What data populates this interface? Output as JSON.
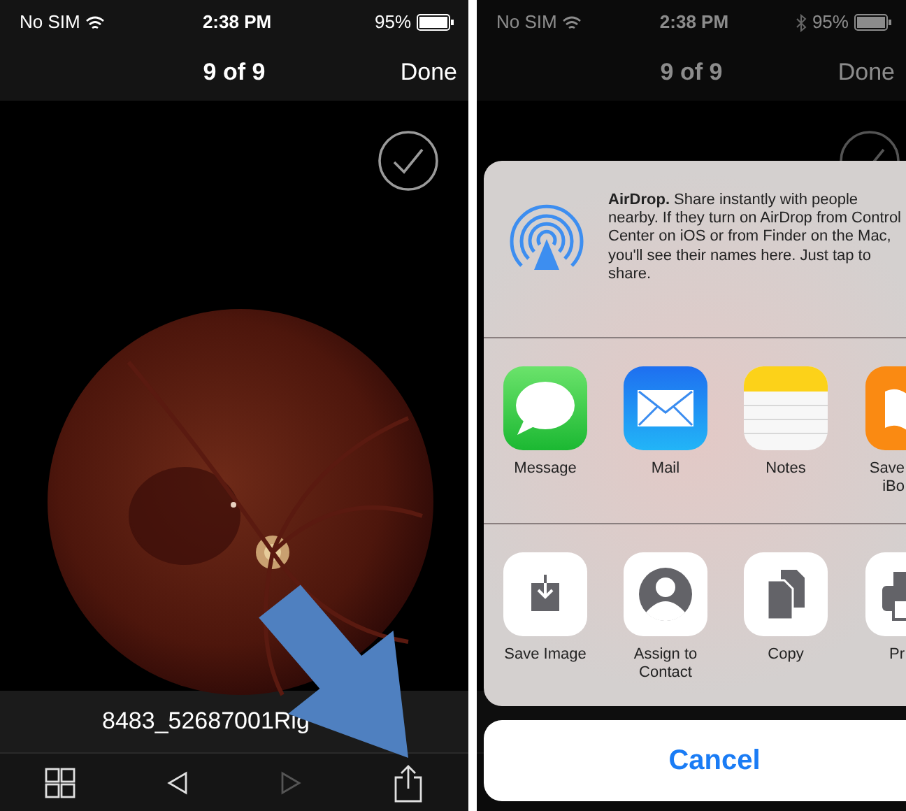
{
  "screens": [
    {
      "status_bar": {
        "carrier": "No SIM",
        "time": "2:38 PM",
        "bluetooth": false,
        "battery": "95%"
      },
      "nav": {
        "title": "9 of 9",
        "action": "Done"
      },
      "caption": "8483_52687001Rig",
      "toolbar": [
        {
          "kind": "grid",
          "disabled": false
        },
        {
          "kind": "prev",
          "disabled": false
        },
        {
          "kind": "next",
          "disabled": true
        },
        {
          "kind": "share",
          "disabled": false
        }
      ],
      "pointer": {
        "kind": "arrow"
      }
    },
    {
      "status_bar": {
        "carrier": "No SIM",
        "time": "2:38 PM",
        "bluetooth": true,
        "battery": "95%"
      },
      "nav": {
        "title": "9 of 9",
        "action": "Done"
      },
      "share_sheet": {
        "airdrop": "**AirDrop.** Share instantly with people nearby. If they turn on AirDrop from Control Center on iOS or from Finder on the Mac, you'll see their names here. Just tap to share.",
        "apps": [
          {
            "kind": "message",
            "label": "Message"
          },
          {
            "kind": "mail",
            "label": "Mail"
          },
          {
            "kind": "notes",
            "label": "Notes"
          },
          {
            "kind": "books",
            "label": "Save\niBo"
          }
        ],
        "actions": [
          {
            "kind": "save",
            "label": "Save Image"
          },
          {
            "kind": "contact",
            "label": "Assign to\nContact"
          },
          {
            "kind": "copy",
            "label": "Copy"
          },
          {
            "kind": "print",
            "label": "Pr"
          }
        ],
        "cancel": "Cancel"
      }
    }
  ]
}
